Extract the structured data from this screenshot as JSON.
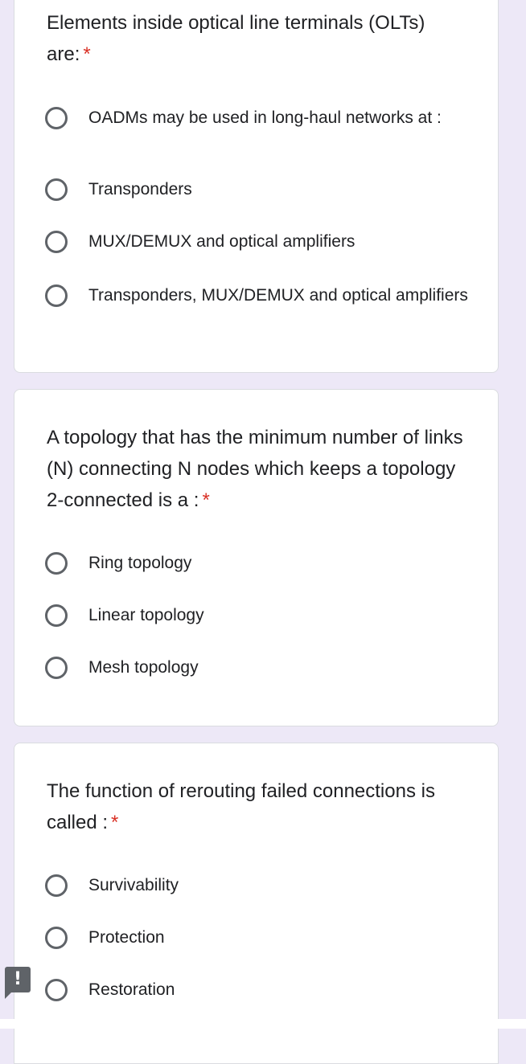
{
  "questions": [
    {
      "text": "Elements inside optical line terminals (OLTs) are:",
      "required_mark": "*",
      "options": [
        "OADMs may be used in long-haul networks at :",
        "Transponders",
        "MUX/DEMUX and optical amplifiers",
        "Transponders, MUX/DEMUX and optical amplifiers"
      ]
    },
    {
      "text": "A topology that has the minimum number of links (N) connecting N nodes which keeps a topology 2-connected is a :",
      "required_mark": "*",
      "options": [
        "Ring topology",
        "Linear topology",
        "Mesh topology"
      ]
    },
    {
      "text": "The function of rerouting failed connections is called :",
      "required_mark": "*",
      "options": [
        "Survivability",
        "Protection",
        "Restoration"
      ]
    }
  ],
  "feedback_button": {
    "icon": "report-icon",
    "glyph": "!"
  }
}
